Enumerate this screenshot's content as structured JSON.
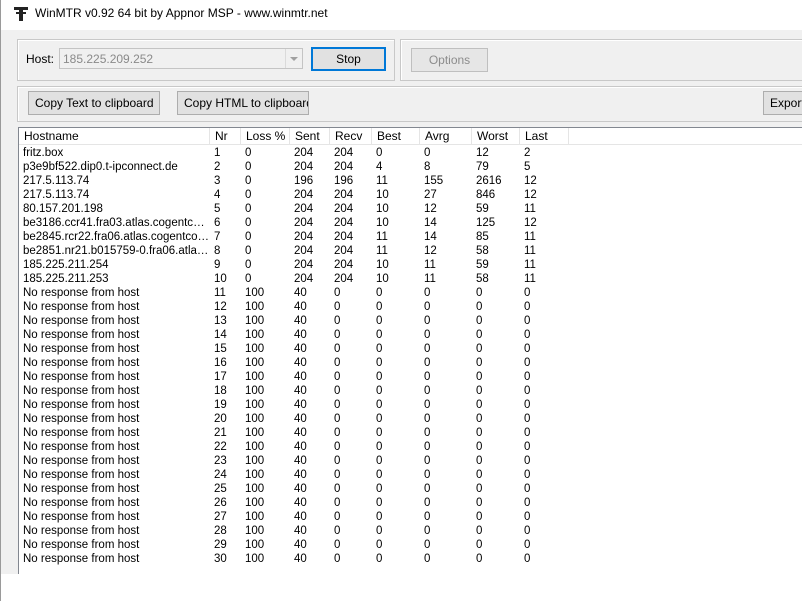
{
  "window": {
    "title": "WinMTR v0.92 64 bit by Appnor MSP - www.winmtr.net"
  },
  "controls": {
    "host_label": "Host:",
    "host_value": "185.225.209.252",
    "stop_label": "Stop",
    "options_label": "Options",
    "copy_text_label": "Copy Text to clipboard",
    "copy_html_label": "Copy HTML to clipboard",
    "export_label": "Export"
  },
  "table": {
    "columns": [
      "Hostname",
      "Nr",
      "Loss %",
      "Sent",
      "Recv",
      "Best",
      "Avrg",
      "Worst",
      "Last"
    ],
    "rows": [
      [
        "fritz.box",
        "1",
        "0",
        "204",
        "204",
        "0",
        "0",
        "12",
        "2"
      ],
      [
        "p3e9bf522.dip0.t-ipconnect.de",
        "2",
        "0",
        "204",
        "204",
        "4",
        "8",
        "79",
        "5"
      ],
      [
        "217.5.113.74",
        "3",
        "0",
        "196",
        "196",
        "11",
        "155",
        "2616",
        "12"
      ],
      [
        "217.5.113.74",
        "4",
        "0",
        "204",
        "204",
        "10",
        "27",
        "846",
        "12"
      ],
      [
        "80.157.201.198",
        "5",
        "0",
        "204",
        "204",
        "10",
        "12",
        "59",
        "11"
      ],
      [
        "be3186.ccr41.fra03.atlas.cogentco.c...",
        "6",
        "0",
        "204",
        "204",
        "10",
        "14",
        "125",
        "12"
      ],
      [
        "be2845.rcr22.fra06.atlas.cogentco.c...",
        "7",
        "0",
        "204",
        "204",
        "11",
        "14",
        "85",
        "11"
      ],
      [
        "be2851.nr21.b015759-0.fra06.atlas.c...",
        "8",
        "0",
        "204",
        "204",
        "11",
        "12",
        "58",
        "11"
      ],
      [
        "185.225.211.254",
        "9",
        "0",
        "204",
        "204",
        "10",
        "11",
        "59",
        "11"
      ],
      [
        "185.225.211.253",
        "10",
        "0",
        "204",
        "204",
        "10",
        "11",
        "58",
        "11"
      ],
      [
        "No response from host",
        "11",
        "100",
        "40",
        "0",
        "0",
        "0",
        "0",
        "0"
      ],
      [
        "No response from host",
        "12",
        "100",
        "40",
        "0",
        "0",
        "0",
        "0",
        "0"
      ],
      [
        "No response from host",
        "13",
        "100",
        "40",
        "0",
        "0",
        "0",
        "0",
        "0"
      ],
      [
        "No response from host",
        "14",
        "100",
        "40",
        "0",
        "0",
        "0",
        "0",
        "0"
      ],
      [
        "No response from host",
        "15",
        "100",
        "40",
        "0",
        "0",
        "0",
        "0",
        "0"
      ],
      [
        "No response from host",
        "16",
        "100",
        "40",
        "0",
        "0",
        "0",
        "0",
        "0"
      ],
      [
        "No response from host",
        "17",
        "100",
        "40",
        "0",
        "0",
        "0",
        "0",
        "0"
      ],
      [
        "No response from host",
        "18",
        "100",
        "40",
        "0",
        "0",
        "0",
        "0",
        "0"
      ],
      [
        "No response from host",
        "19",
        "100",
        "40",
        "0",
        "0",
        "0",
        "0",
        "0"
      ],
      [
        "No response from host",
        "20",
        "100",
        "40",
        "0",
        "0",
        "0",
        "0",
        "0"
      ],
      [
        "No response from host",
        "21",
        "100",
        "40",
        "0",
        "0",
        "0",
        "0",
        "0"
      ],
      [
        "No response from host",
        "22",
        "100",
        "40",
        "0",
        "0",
        "0",
        "0",
        "0"
      ],
      [
        "No response from host",
        "23",
        "100",
        "40",
        "0",
        "0",
        "0",
        "0",
        "0"
      ],
      [
        "No response from host",
        "24",
        "100",
        "40",
        "0",
        "0",
        "0",
        "0",
        "0"
      ],
      [
        "No response from host",
        "25",
        "100",
        "40",
        "0",
        "0",
        "0",
        "0",
        "0"
      ],
      [
        "No response from host",
        "26",
        "100",
        "40",
        "0",
        "0",
        "0",
        "0",
        "0"
      ],
      [
        "No response from host",
        "27",
        "100",
        "40",
        "0",
        "0",
        "0",
        "0",
        "0"
      ],
      [
        "No response from host",
        "28",
        "100",
        "40",
        "0",
        "0",
        "0",
        "0",
        "0"
      ],
      [
        "No response from host",
        "29",
        "100",
        "40",
        "0",
        "0",
        "0",
        "0",
        "0"
      ],
      [
        "No response from host",
        "30",
        "100",
        "40",
        "0",
        "0",
        "0",
        "0",
        "0"
      ]
    ]
  },
  "icons": {
    "app": "winmtr-app-icon",
    "combo_arrow": "chevron-down-icon"
  }
}
